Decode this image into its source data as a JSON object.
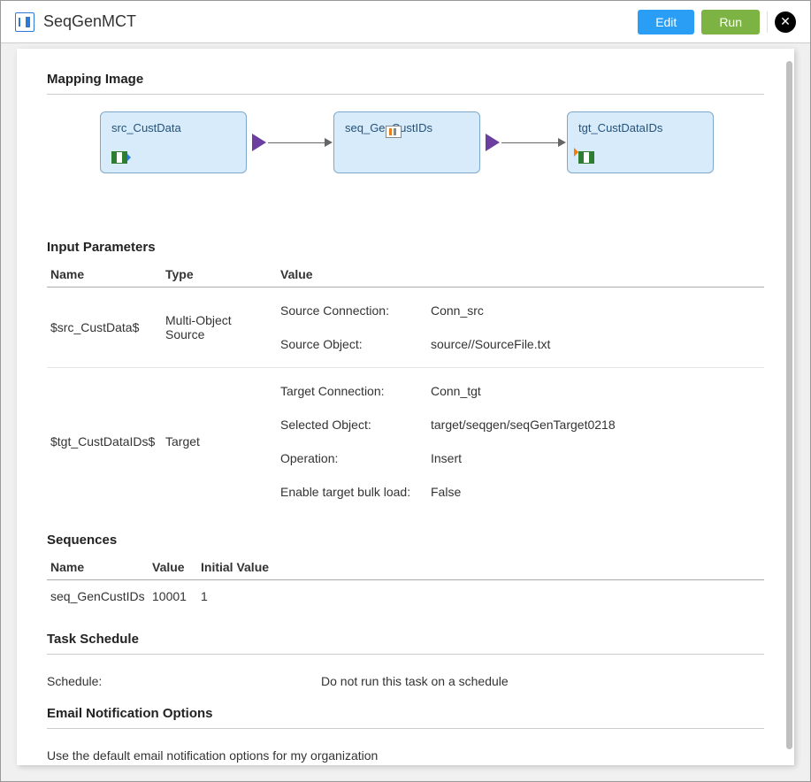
{
  "header": {
    "title": "SeqGenMCT",
    "edit_label": "Edit",
    "run_label": "Run"
  },
  "mapping": {
    "section_title": "Mapping Image",
    "nodes": [
      {
        "label": "src_CustData"
      },
      {
        "label": "seq_GenCustIDs"
      },
      {
        "label": "tgt_CustDataIDs"
      }
    ]
  },
  "input_parameters": {
    "section_title": "Input Parameters",
    "columns": {
      "name": "Name",
      "type": "Type",
      "value": "Value"
    },
    "rows": [
      {
        "name": "$src_CustData$",
        "type": "Multi-Object Source",
        "kv": [
          {
            "k": "Source Connection:",
            "v": "Conn_src"
          },
          {
            "k": "Source Object:",
            "v": "source//SourceFile.txt"
          }
        ]
      },
      {
        "name": "$tgt_CustDataIDs$",
        "type": "Target",
        "kv": [
          {
            "k": "Target Connection:",
            "v": "Conn_tgt"
          },
          {
            "k": "Selected Object:",
            "v": "target/seqgen/seqGenTarget0218"
          },
          {
            "k": "Operation:",
            "v": "Insert"
          },
          {
            "k": "Enable target bulk load:",
            "v": "False"
          }
        ]
      }
    ]
  },
  "sequences": {
    "section_title": "Sequences",
    "columns": {
      "name": "Name",
      "value": "Value",
      "initial": "Initial Value"
    },
    "rows": [
      {
        "name": "seq_GenCustIDs",
        "value": "10001",
        "initial": "1"
      }
    ]
  },
  "task_schedule": {
    "section_title": "Task Schedule",
    "label": "Schedule:",
    "value": "Do not run this task on a schedule"
  },
  "email": {
    "section_title": "Email Notification Options",
    "text": "Use the default email notification options for my organization"
  }
}
